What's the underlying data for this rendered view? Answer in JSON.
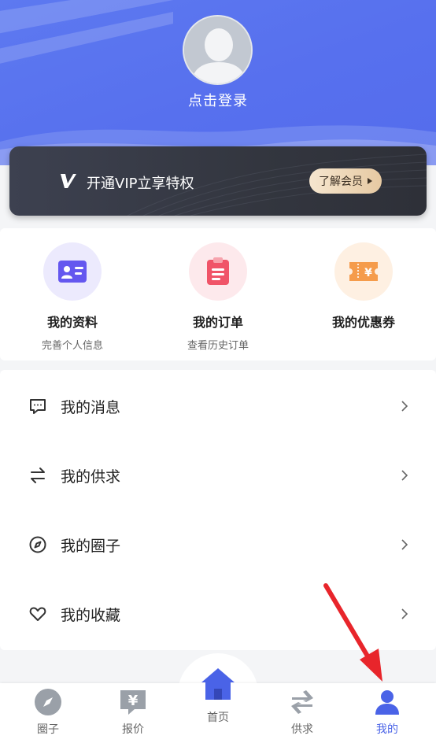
{
  "header": {
    "login_text": "点击登录"
  },
  "vip": {
    "title": "开通VIP立享特权",
    "button": "了解会员"
  },
  "quick": [
    {
      "title": "我的资料",
      "subtitle": "完善个人信息",
      "icon": "profile-card-icon",
      "color": "#6457ef"
    },
    {
      "title": "我的订单",
      "subtitle": "查看历史订单",
      "icon": "clipboard-icon",
      "color": "#f05468"
    },
    {
      "title": "我的优惠券",
      "subtitle": "",
      "icon": "coupon-icon",
      "color": "#f59c4c"
    }
  ],
  "menu": [
    {
      "label": "我的消息",
      "icon": "message-icon"
    },
    {
      "label": "我的供求",
      "icon": "exchange-icon"
    },
    {
      "label": "我的圈子",
      "icon": "compass-icon"
    },
    {
      "label": "我的收藏",
      "icon": "heart-icon"
    }
  ],
  "tabs": [
    {
      "label": "圈子",
      "icon": "compass-icon"
    },
    {
      "label": "报价",
      "icon": "price-icon"
    },
    {
      "label": "首页",
      "icon": "home-icon"
    },
    {
      "label": "供求",
      "icon": "exchange-icon"
    },
    {
      "label": "我的",
      "icon": "user-icon",
      "active": true
    }
  ],
  "colors": {
    "header_blue": "#5770ee",
    "active_tab": "#4a63e7",
    "annotation_arrow": "#e8252b"
  }
}
